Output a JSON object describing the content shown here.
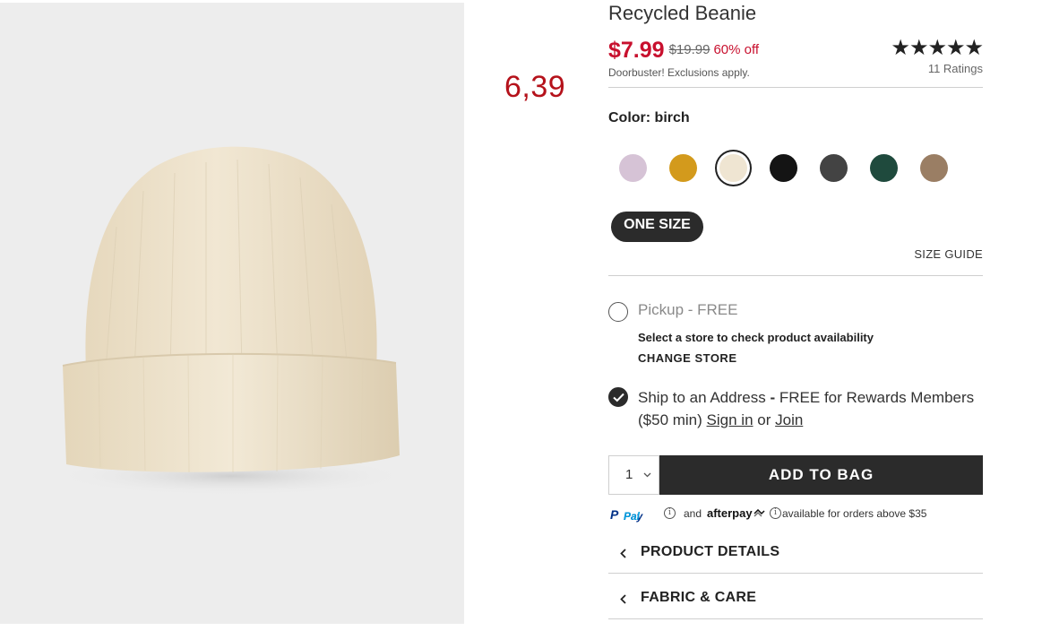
{
  "overlay_price": "6,39",
  "product": {
    "title": "Recycled Beanie",
    "price_current": "$7.99",
    "price_original": "$19.99",
    "discount": "60% off",
    "promo_note": "Doorbuster! Exclusions apply.",
    "stars": "★★★★★",
    "ratings_count": "11 Ratings",
    "rating_value": 5
  },
  "color": {
    "label": "Color: birch",
    "swatches": [
      {
        "name": "lavender",
        "hex": "#d6c3d6"
      },
      {
        "name": "mustard",
        "hex": "#d39a1c"
      },
      {
        "name": "birch",
        "hex": "#efe5d2",
        "selected": true
      },
      {
        "name": "black",
        "hex": "#141414"
      },
      {
        "name": "charcoal",
        "hex": "#434343"
      },
      {
        "name": "green",
        "hex": "#1f4a3d"
      },
      {
        "name": "brown",
        "hex": "#9a7e64"
      }
    ]
  },
  "size": {
    "selected": "ONE SIZE",
    "guide_label": "SIZE GUIDE"
  },
  "fulfillment": {
    "pickup_label": "Pickup",
    "pickup_price": "FREE",
    "store_check_text": "Select a store to check product availability",
    "change_store_label": "CHANGE STORE",
    "ship_label": "Ship to an Address",
    "ship_price": "FREE",
    "ship_rest": "for Rewards Members ($50 min)",
    "sign_in_label": "Sign in",
    "or_text": "or",
    "join_label": "Join"
  },
  "purchase": {
    "quantity": "1",
    "add_to_bag_label": "ADD TO BAG"
  },
  "payment": {
    "paypal_p": "P",
    "paypal_pay": "Pay",
    "paypal_pal": "Pal",
    "and_text": "and",
    "afterpay_label": "afterpay",
    "availability_text": "available for orders above $35"
  },
  "accordion": {
    "items": [
      {
        "label": "PRODUCT DETAILS"
      },
      {
        "label": "FABRIC & CARE"
      }
    ]
  },
  "colors": {
    "sale_red": "#c8102e",
    "overlay_red": "#b5121b",
    "button_dark": "#2b2b2b",
    "image_bg": "#ededed"
  },
  "icons": {
    "check": "check-icon",
    "qty_chevron": "chevron-down-icon",
    "accordion_chevron": "chevron-left-icon",
    "info": "info-icon"
  }
}
